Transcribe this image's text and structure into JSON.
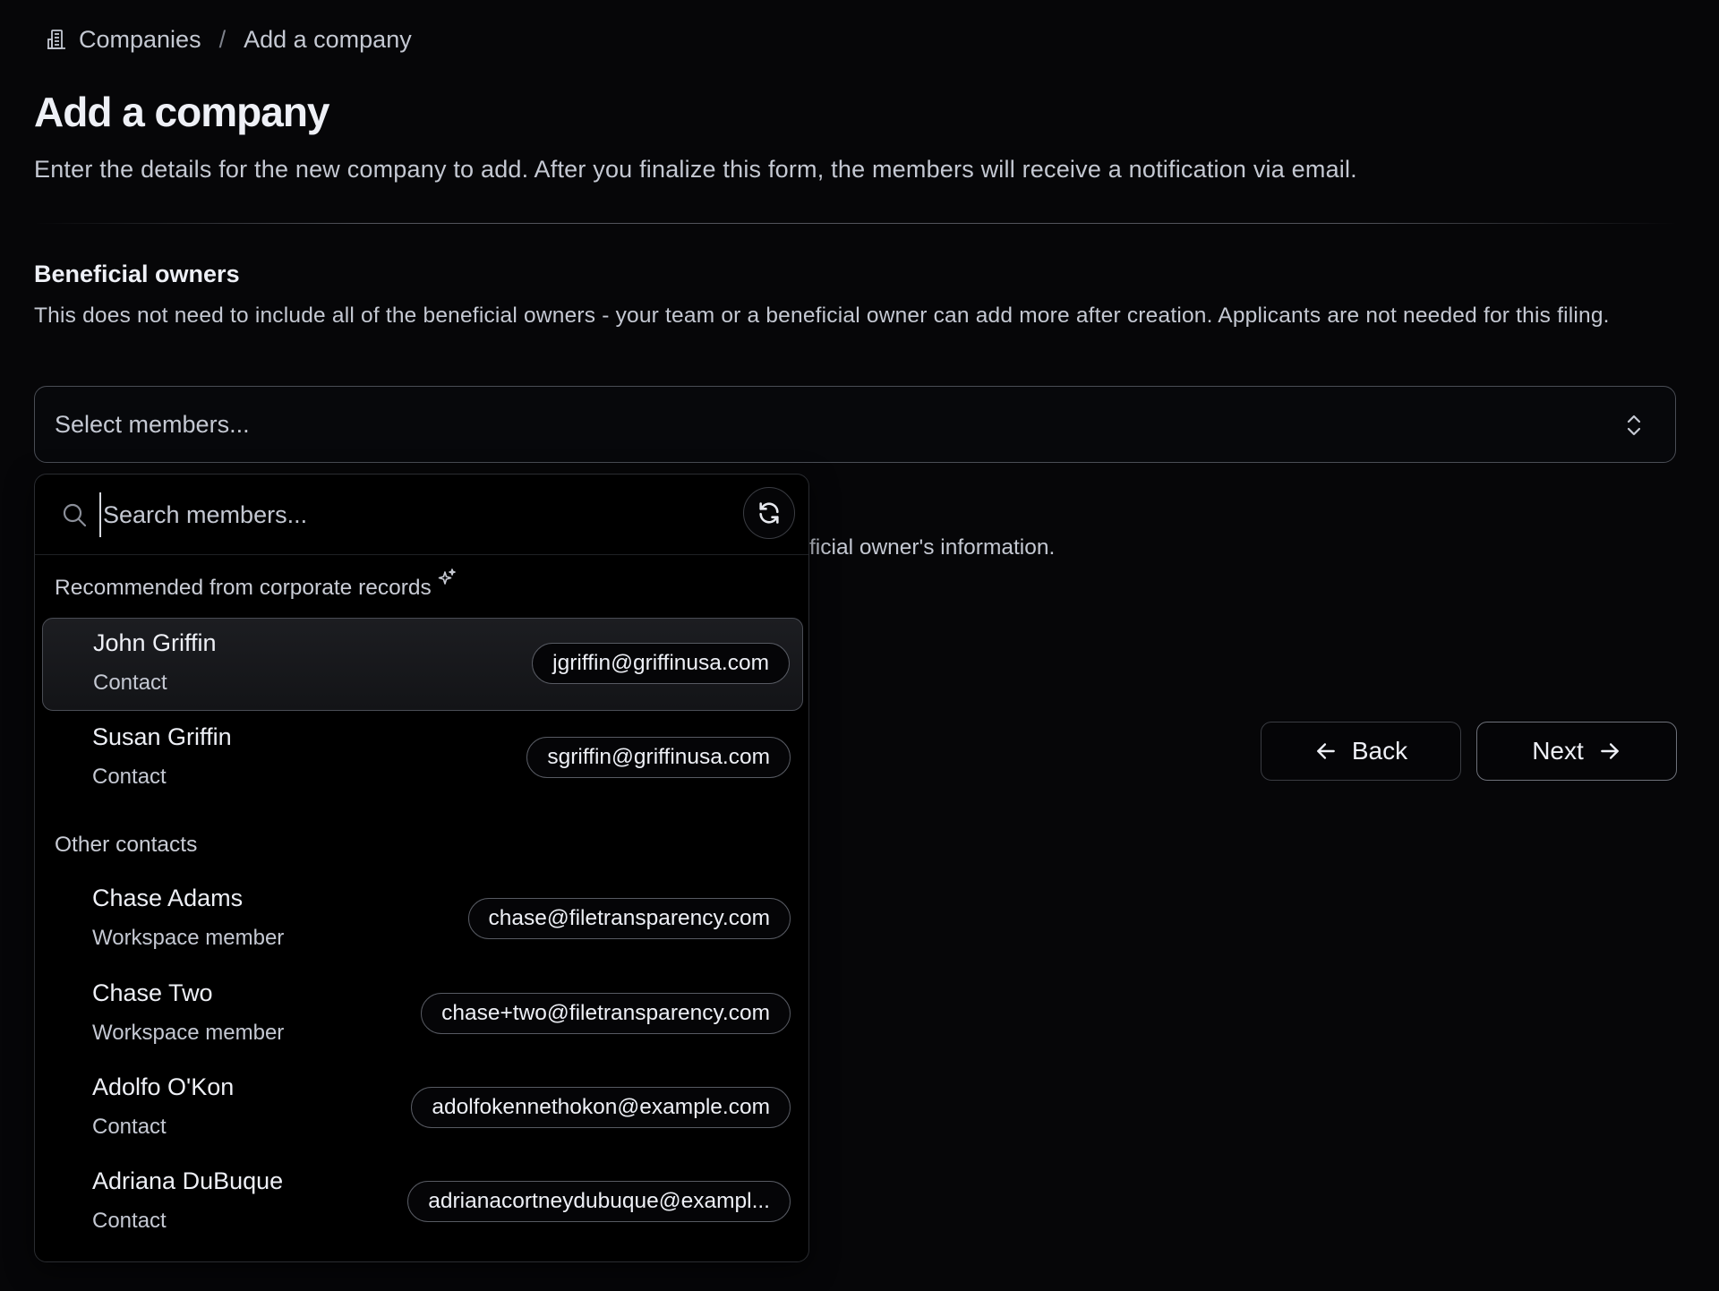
{
  "breadcrumb": {
    "icon": "building-icon",
    "items": [
      "Companies",
      "Add a company"
    ],
    "separator": "/"
  },
  "header": {
    "title": "Add a company",
    "subtitle": "Enter the details for the new company to add. After you finalize this form, the members will receive a notification via email."
  },
  "section": {
    "title": "Beneficial owners",
    "description": "This does not need to include all of the beneficial owners - your team or a beneficial owner can add more after creation. Applicants are not needed for this filing.",
    "obscured_text": "ficial owner's information."
  },
  "select": {
    "placeholder": "Select members...",
    "icon": "chevrons-up-down-icon"
  },
  "dropdown": {
    "search_placeholder": "Search members...",
    "search_value": "",
    "refresh_icon": "refresh-icon",
    "groups": [
      {
        "label": "Recommended from corporate records",
        "icon": "sparkle-icon",
        "items": [
          {
            "name": "John Griffin",
            "role": "Contact",
            "email": "jgriffin@griffinusa.com",
            "highlighted": true
          },
          {
            "name": "Susan Griffin",
            "role": "Contact",
            "email": "sgriffin@griffinusa.com",
            "highlighted": false
          }
        ]
      },
      {
        "label": "Other contacts",
        "items": [
          {
            "name": "Chase Adams",
            "role": "Workspace member",
            "email": "chase@filetransparency.com"
          },
          {
            "name": "Chase Two",
            "role": "Workspace member",
            "email": "chase+two@filetransparency.com"
          },
          {
            "name": "Adolfo O'Kon",
            "role": "Contact",
            "email": "adolfokennethokon@example.com"
          },
          {
            "name": "Adriana DuBuque",
            "role": "Contact",
            "email": "adrianacortneydubuque@exampl..."
          }
        ]
      }
    ]
  },
  "actions": {
    "back_label": "Back",
    "next_label": "Next"
  }
}
